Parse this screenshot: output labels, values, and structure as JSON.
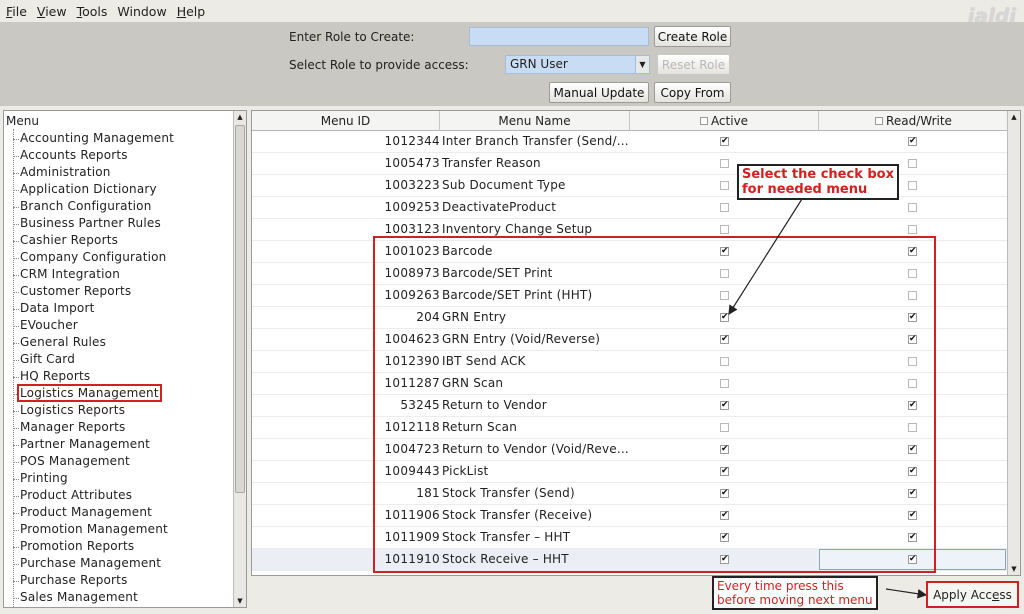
{
  "menubar": {
    "items": [
      {
        "first": "F",
        "rest": "ile"
      },
      {
        "first": "V",
        "rest": "iew"
      },
      {
        "first": "T",
        "rest": "ools"
      },
      {
        "first": "",
        "rest": "Window"
      },
      {
        "first": "H",
        "rest": "elp"
      }
    ],
    "logo": "jaldi"
  },
  "top": {
    "enter_role_label": "Enter Role to Create:",
    "enter_role_value": "",
    "create_role": "Create Role",
    "select_role_label": "Select Role to provide access:",
    "selected_role": "GRN User",
    "reset_role": "Reset Role",
    "manual_update": "Manual Update",
    "copy_from": "Copy  From"
  },
  "menu_tree": {
    "root": "Menu",
    "items": [
      "Accounting Management",
      "Accounts Reports",
      "Administration",
      "Application Dictionary",
      "Branch Configuration",
      "Business Partner Rules",
      "Cashier Reports",
      "Company Configuration",
      "CRM Integration",
      "Customer Reports",
      "Data Import",
      "EVoucher",
      "General Rules",
      "Gift Card",
      "HQ Reports",
      "Logistics Management",
      "Logistics Reports",
      "Manager Reports",
      "Partner Management",
      "POS Management",
      "Printing",
      "Product Attributes",
      "Product Management",
      "Promotion Management",
      "Promotion Reports",
      "Purchase Management",
      "Purchase Reports",
      "Sales Management"
    ],
    "highlighted": "Logistics Management"
  },
  "table": {
    "headers": {
      "menu_id": "Menu ID",
      "menu_name": "Menu Name",
      "active": "Active",
      "read_write": "Read/Write"
    },
    "rows": [
      {
        "id": "1012344",
        "name": "Inter Branch Transfer (Send/...",
        "active": true,
        "rw": true
      },
      {
        "id": "1005473",
        "name": "Transfer Reason",
        "active": false,
        "rw": false
      },
      {
        "id": "1003223",
        "name": "Sub Document Type",
        "active": false,
        "rw": false
      },
      {
        "id": "1009253",
        "name": "DeactivateProduct",
        "active": false,
        "rw": false
      },
      {
        "id": "1003123",
        "name": "Inventory Change Setup",
        "active": false,
        "rw": false
      },
      {
        "id": "1001023",
        "name": "Barcode",
        "active": true,
        "rw": true
      },
      {
        "id": "1008973",
        "name": "Barcode/SET Print",
        "active": false,
        "rw": false
      },
      {
        "id": "1009263",
        "name": "Barcode/SET Print (HHT)",
        "active": false,
        "rw": false
      },
      {
        "id": "204",
        "name": "GRN Entry",
        "active": true,
        "rw": true
      },
      {
        "id": "1004623",
        "name": "GRN Entry (Void/Reverse)",
        "active": true,
        "rw": true
      },
      {
        "id": "1012390",
        "name": "IBT Send ACK",
        "active": false,
        "rw": false
      },
      {
        "id": "1011287",
        "name": "GRN Scan",
        "active": false,
        "rw": false
      },
      {
        "id": "53245",
        "name": "Return to Vendor",
        "active": true,
        "rw": true
      },
      {
        "id": "1012118",
        "name": "Return Scan",
        "active": false,
        "rw": false
      },
      {
        "id": "1004723",
        "name": "Return to Vendor (Void/Reve...",
        "active": true,
        "rw": true
      },
      {
        "id": "1009443",
        "name": "PickList",
        "active": true,
        "rw": true
      },
      {
        "id": "181",
        "name": "Stock Transfer (Send)",
        "active": true,
        "rw": true
      },
      {
        "id": "1011906",
        "name": "Stock Transfer (Receive)",
        "active": true,
        "rw": true
      },
      {
        "id": "1011909",
        "name": "Stock Transfer – HHT",
        "active": true,
        "rw": true
      },
      {
        "id": "1011910",
        "name": "Stock Receive – HHT",
        "active": true,
        "rw": true
      }
    ]
  },
  "annotations": {
    "select_checkbox": [
      "Select the check box",
      "for needed menu"
    ],
    "press_every_time": [
      "Every time press this",
      "before moving next menu"
    ]
  },
  "apply_access": {
    "first": "Apply Acc",
    "u": "e",
    "rest": "ss"
  },
  "colors": {
    "annotation_red": "#d21f1f",
    "input_blue": "#c8dcf3",
    "toolbar_gray": "#cac8c3"
  }
}
